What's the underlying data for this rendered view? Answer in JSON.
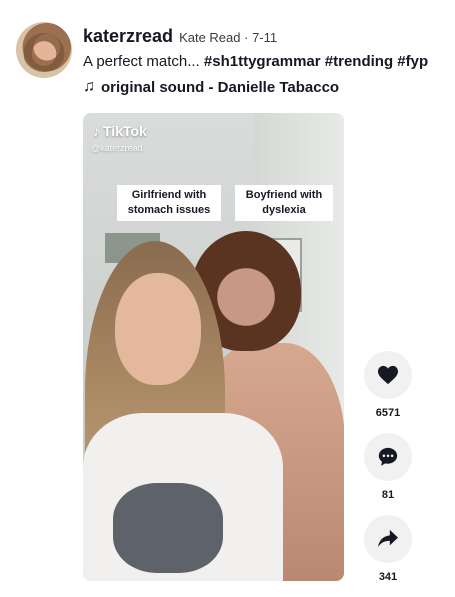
{
  "author": {
    "username": "katerzread",
    "nickname": "Kate Read",
    "separator": " · ",
    "date": "7-11"
  },
  "caption": {
    "text": "A perfect match... ",
    "hashtags": [
      "#sh1ttygrammar",
      "#trending",
      "#fyp"
    ]
  },
  "music": {
    "icon": "music-note-icon",
    "title": "original sound - Danielle Tabacco"
  },
  "video": {
    "watermark": "TikTok",
    "handle": "@katerzread",
    "overlay_left": "Girlfriend with stomach issues",
    "overlay_right": "Boyfriend with dyslexia"
  },
  "actions": {
    "likes": "6571",
    "comments": "81",
    "shares": "341"
  }
}
